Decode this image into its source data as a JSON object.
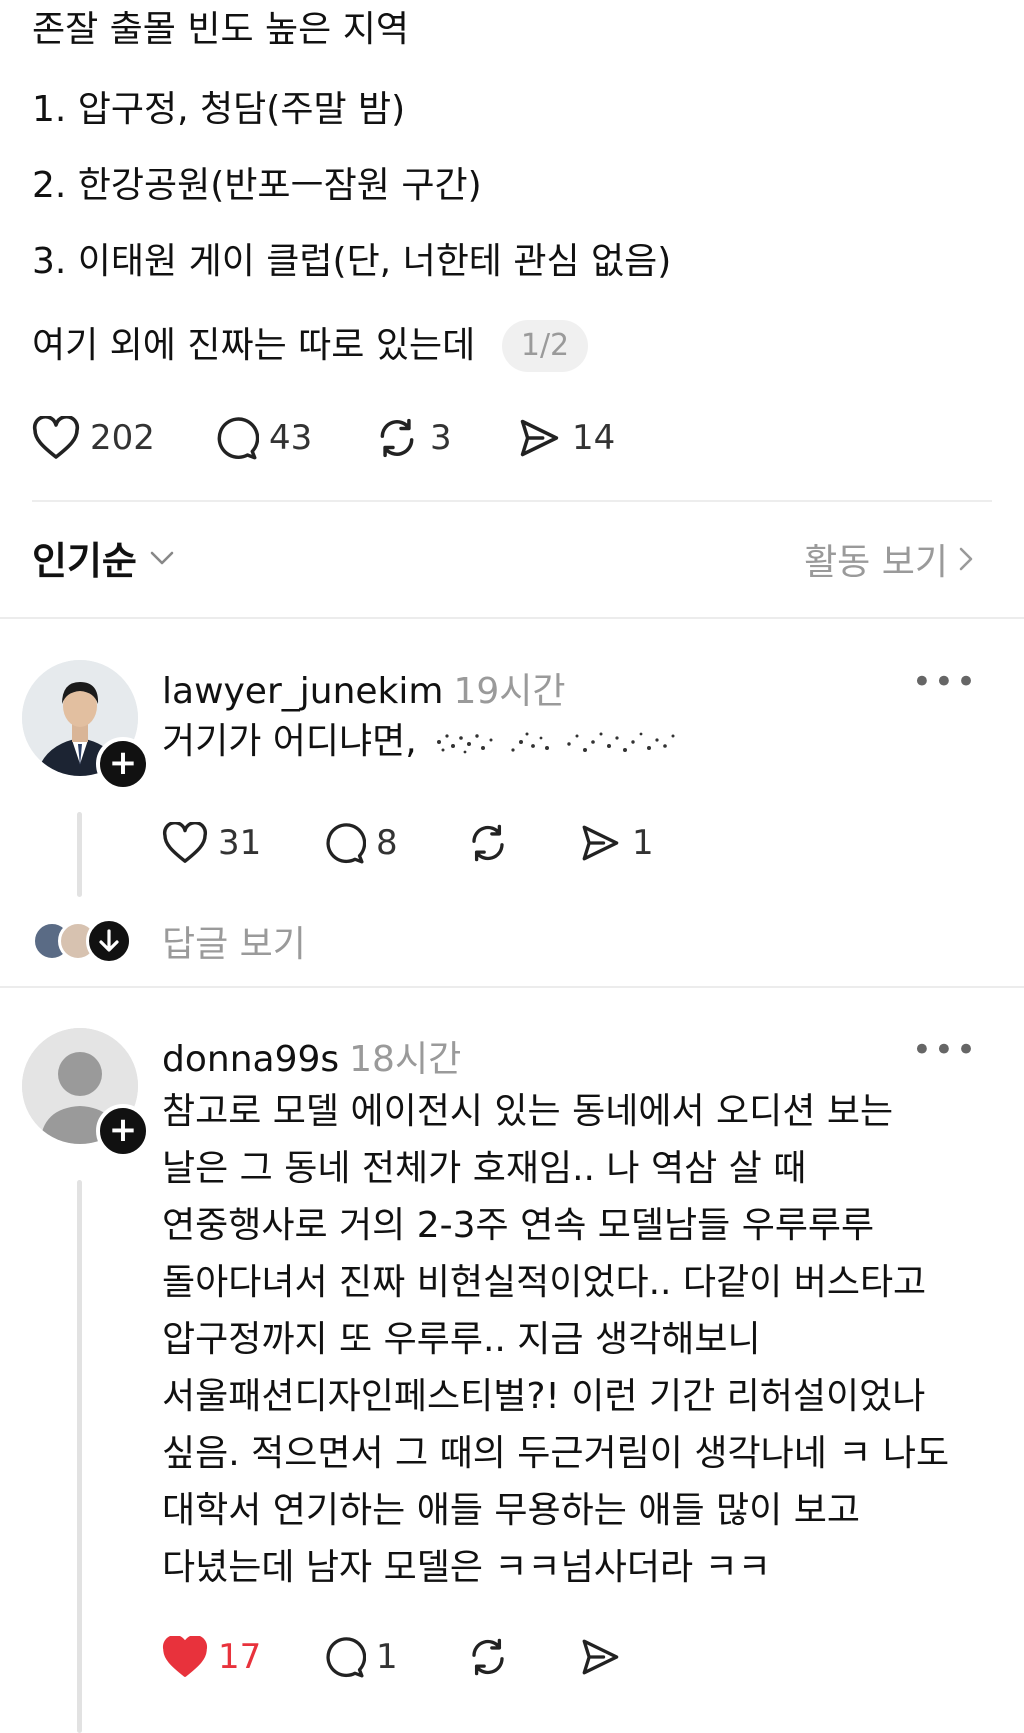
{
  "post": {
    "lines": [
      "존잘 출몰 빈도 높은 지역",
      "1. 압구정, 청담(주말 밤)",
      "2. 한강공원(반포ㅡ잠원 구간)",
      "3. 이태원 게이 클럽(단, 너한테 관심 없음)",
      "여기 외에 진짜는 따로 있는데"
    ],
    "pager": "1/2",
    "actions": {
      "likes": "202",
      "comments": "43",
      "reposts": "3",
      "shares": "14"
    }
  },
  "sort": {
    "label": "인기순",
    "activity_label": "활동 보기"
  },
  "comments": [
    {
      "username": "lawyer_junekim",
      "time": "19시간",
      "text": "거기가 어디냐면,",
      "actions": {
        "likes": "31",
        "comments": "8",
        "reposts": "",
        "shares": "1"
      },
      "view_replies": "답글 보기"
    },
    {
      "username": "donna99s",
      "time": "18시간",
      "lines": [
        "참고로 모델 에이전시 있는 동네에서 오디션 보는",
        "날은 그 동네 전체가 호재임.. 나 역삼 살 때",
        "연중행사로 거의 2-3주 연속 모델남들 우루루루",
        "돌아다녀서 진짜 비현실적이었다.. 다같이 버스타고",
        "압구정까지 또 우루루.. 지금 생각해보니",
        "서울패션디자인페스티벌?! 이런 기간 리허설이었나",
        "싶음. 적으면서 그 때의 두근거림이 생각나네 ㅋ 나도",
        "대학서 연기하는 애들 무용하는 애들 많이 보고",
        "다녔는데 남자 모델은 ㅋㅋ넘사더라 ㅋㅋ"
      ],
      "actions": {
        "likes": "17",
        "comments": "1",
        "reposts": "",
        "shares": ""
      },
      "liked": true
    }
  ],
  "colors": {
    "liked": "#e8323c",
    "muted": "#9a9a9a"
  }
}
